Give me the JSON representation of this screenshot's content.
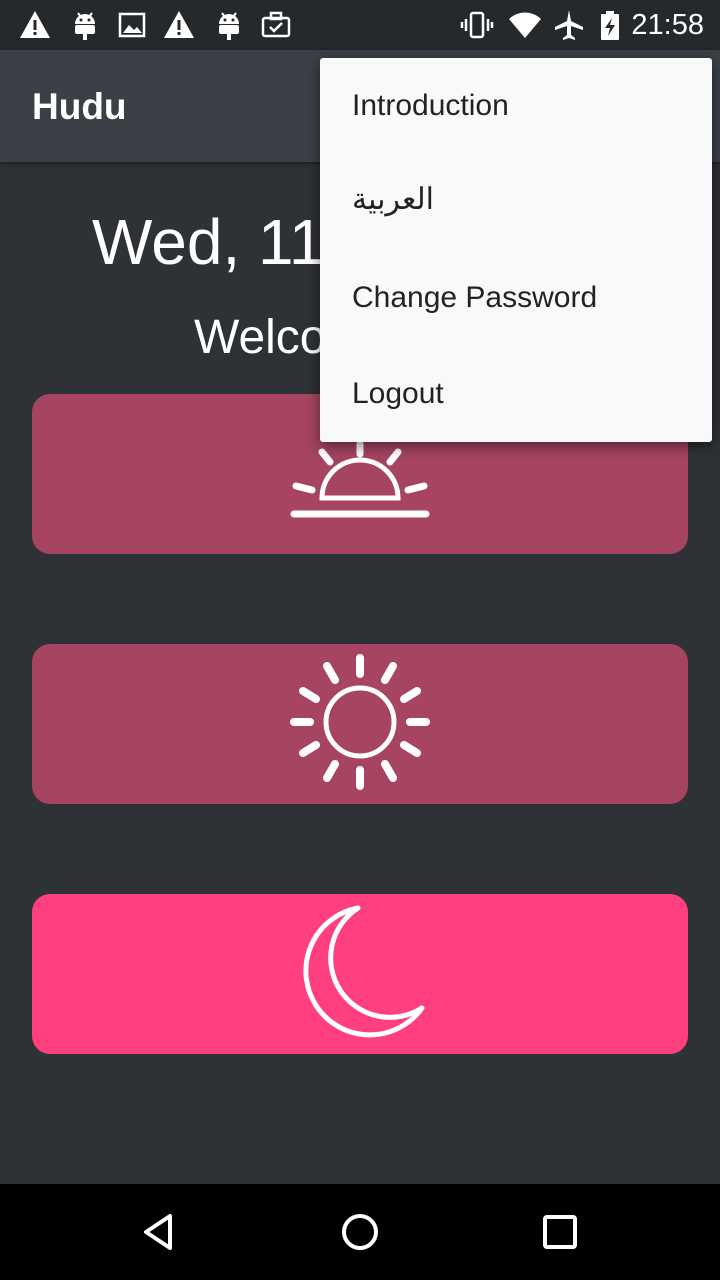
{
  "status_bar": {
    "time": "21:58",
    "icons_left": [
      "warning-icon",
      "android-icon",
      "image-icon",
      "warning-icon",
      "android-icon",
      "briefcase-icon"
    ],
    "icons_right": [
      "vibrate-icon",
      "wifi-icon",
      "airplane-icon",
      "battery-charging-icon"
    ]
  },
  "app_bar": {
    "title": "Hudu"
  },
  "main": {
    "date": "Wed, 11",
    "welcome": "Welco"
  },
  "cards": [
    {
      "icon": "sunrise-icon",
      "color": "#a64462"
    },
    {
      "icon": "sun-icon",
      "color": "#a64462"
    },
    {
      "icon": "moon-icon",
      "color": "#ff3f7e"
    }
  ],
  "menu": {
    "items": [
      {
        "label": "Introduction"
      },
      {
        "label": "العربية"
      },
      {
        "label": "Change Password"
      },
      {
        "label": "Logout"
      }
    ]
  },
  "nav_bar": {
    "buttons": [
      "back-icon",
      "home-icon",
      "recents-icon"
    ]
  }
}
